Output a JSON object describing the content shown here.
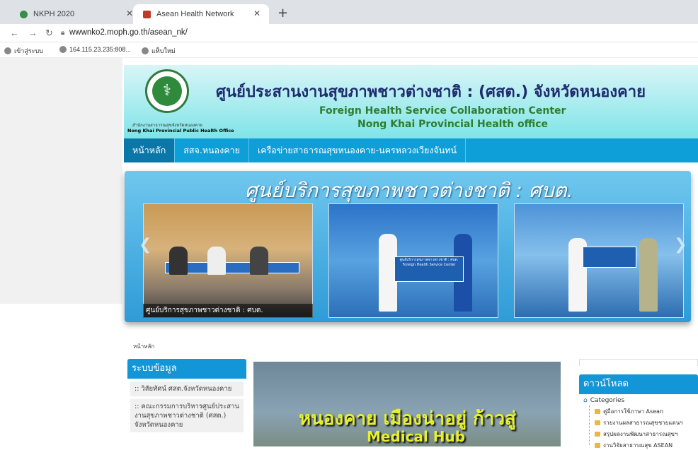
{
  "browser": {
    "tabs": [
      {
        "title": "NKPH 2020",
        "active": false
      },
      {
        "title": "Asean Health Network",
        "active": true
      }
    ],
    "url": "wwwnko2.moph.go.th/asean_nk/",
    "bookmarks": [
      "เข้าสู่ระบบ",
      "164.115.23.235:808...",
      "แท็บใหม่"
    ]
  },
  "header": {
    "org_th": "สำนักงานสาธารณสุขจังหวัดหนองคาย",
    "org_en": "Nong Khai Provincial Public Health Office",
    "title_th": "ศูนย์ประสานงานสุขภาพชาวต่างชาติ : (ศสต.) จังหวัดหนองคาย",
    "title_en_1": "Foreign Health Service Collaboration Center",
    "title_en_2": "Nong Khai Provincial Health office"
  },
  "menu": [
    {
      "label": "หน้าหลัก",
      "active": true
    },
    {
      "label": "สสจ.หนองคาย",
      "active": false
    },
    {
      "label": "เครือข่ายสาธารณสุขหนองคาย-นครหลวงเวียงจันทน์",
      "active": false
    }
  ],
  "slider": {
    "title": "ศูนย์บริการสุขภาพชาวต่างชาติ : ศบต.",
    "caption": "ศูนย์บริการสุขภาพชาวต่างชาติ : ศบต.",
    "sign_text": "ศูนย์บริการสุขภาพชาวต่างชาติ : ศบต.",
    "sign_text_en": "Foreign Health Service Center"
  },
  "breadcrumb": "หน้าหลัก",
  "sidebar": {
    "heading": "ระบบข้อมูล",
    "items": [
      ":: วิสัยทัศน์ ศสต.จังหวัดหนองคาย",
      ":: คณะกรรมการบริหารศูนย์ประสานงานสุขภาพชาวต่างชาติ (ศสต.) จังหวัดหนองคาย"
    ]
  },
  "video": {
    "line1": "หนองคาย เมืองน่าอยู่ ก้าวสู่",
    "line2": "Medical Hub"
  },
  "downloads": {
    "heading": "ดาวน์โหลด",
    "root": "Categories",
    "items": [
      "คู่มือการใช้ภาษา Asean",
      "รายงานผลสาธารณสุขชายแดนฯ",
      "สรุปผลงานพัฒนาสาธารณสุขฯ",
      "งานวิจัยสาธารณสุข ASEAN"
    ]
  }
}
